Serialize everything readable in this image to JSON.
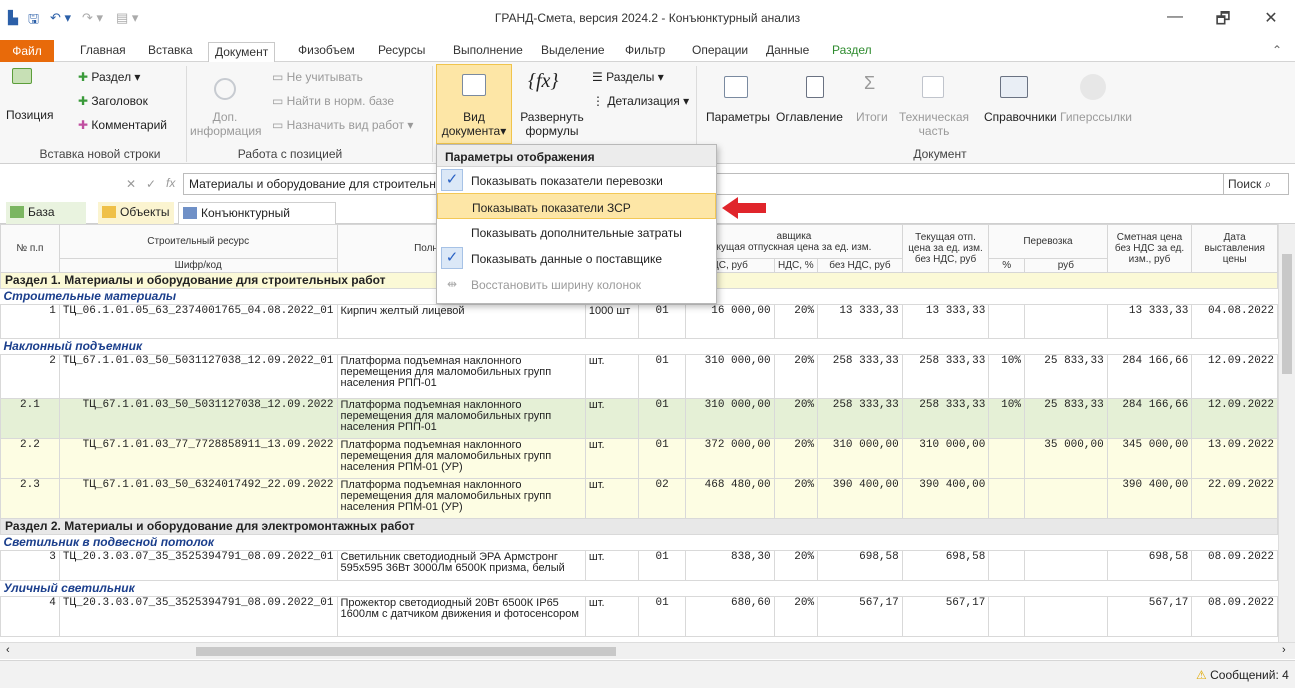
{
  "window": {
    "title": "ГРАНД-Смета, версия 2024.2 - Конъюнктурный анализ",
    "minimize": "—",
    "restore": "🗗",
    "close": "✕"
  },
  "tabs": {
    "file": "Файл",
    "items": [
      "Главная",
      "Вставка",
      "Документ",
      "Физобъем",
      "Ресурсы",
      "Выполнение",
      "Выделение",
      "Фильтр",
      "Операции",
      "Данные",
      "Раздел"
    ],
    "active": "Документ"
  },
  "ribbon": {
    "insert": {
      "position": "Позиция",
      "section": "Раздел",
      "heading": "Заголовок",
      "comment": "Комментарий",
      "group": "Вставка новой строки"
    },
    "work": {
      "info1": "Доп.",
      "info2": "информация",
      "ignore": "Не учитывать",
      "find": "Найти в норм. базе",
      "assign": "Назначить вид работ",
      "group": "Работа с позицией"
    },
    "view": {
      "label1": "Вид",
      "label2": "документа",
      "expand1": "Развернуть",
      "expand2": "формулы",
      "sections": "Разделы",
      "detail": "Детализация"
    },
    "doc": {
      "params": "Параметры",
      "toc": "Оглавление",
      "totals": "Итоги",
      "tech1": "Техническая",
      "tech2": "часть",
      "refs": "Справочники",
      "links": "Гиперссылки",
      "group": "Документ"
    }
  },
  "formula": {
    "value": "Материалы  и оборудование для строительных работ",
    "search": "Поиск"
  },
  "doctabs": {
    "base": "База",
    "objects": "Объекты",
    "market": "Конъюнктурный анализ",
    "close": "×"
  },
  "menu": {
    "header": "Параметры отображения",
    "items": [
      {
        "label": "Показывать показатели перевозки",
        "checked": true,
        "state": "normal"
      },
      {
        "label": "Показывать показатели ЗСР",
        "checked": false,
        "state": "highlight"
      },
      {
        "label": "Показывать дополнительные затраты",
        "checked": false,
        "state": "normal"
      },
      {
        "label": "Показывать данные о поставщике",
        "checked": true,
        "state": "normal"
      },
      {
        "label": "Восстановить ширину колонок",
        "checked": false,
        "state": "disabled"
      }
    ]
  },
  "grid": {
    "headers": {
      "num": "№ п.п",
      "resource": "Строительный ресурс",
      "code": "Шифр/код",
      "fullname": "Полное наименован",
      "supplier": "авщика",
      "supplier_sub": "кущая отпускная цена за ед. изм.",
      "nds_price": "ДС, руб",
      "nds": "НДС, %",
      "no_nds": "без НДС, руб",
      "cur_price": "Текущая отп. цена за ед. изм. без НДС, руб",
      "transport": "Перевозка",
      "tr_pct": "%",
      "tr_rub": "руб",
      "est_price": "Сметная цена без НДС за ед. изм., руб",
      "date": "Дата выставления цены"
    },
    "rows": [
      {
        "type": "section",
        "text": "Раздел 1. Материалы  и оборудование для строительных работ",
        "hl": true
      },
      {
        "type": "group",
        "text": "Строительные материалы"
      },
      {
        "type": "item",
        "n": "1",
        "code": "ТЦ_06.1.01.05_63_2374001765_04.08.2022_01",
        "name": "Кирпич желтый лицевой",
        "unit": "1000 шт",
        "k": "01",
        "price": "16 000,00",
        "nds": "20%",
        "nonds": "13 333,33",
        "cur": "13 333,33",
        "trp": "",
        "trr": "",
        "est": "13 333,33",
        "date": "04.08.2022",
        "cls": ""
      },
      {
        "type": "group",
        "text": "Наклонный подъемник"
      },
      {
        "type": "item",
        "n": "2",
        "code": "ТЦ_67.1.01.03_50_5031127038_12.09.2022_01",
        "name": "Платформа подъемная наклонного перемещения для маломобильных групп населения РПП-01",
        "unit": "шт.",
        "k": "01",
        "price": "310 000,00",
        "nds": "20%",
        "nonds": "258 333,33",
        "cur": "258 333,33",
        "trp": "10%",
        "trr": "25 833,33",
        "est": "284 166,66",
        "date": "12.09.2022",
        "cls": ""
      },
      {
        "type": "item",
        "n": "2.1",
        "code": "ТЦ_67.1.01.03_50_5031127038_12.09.2022",
        "name": "Платформа подъемная наклонного перемещения для маломобильных групп населения РПП-01",
        "unit": "шт.",
        "k": "01",
        "price": "310 000,00",
        "nds": "20%",
        "nonds": "258 333,33",
        "cur": "258 333,33",
        "trp": "10%",
        "trr": "25 833,33",
        "est": "284 166,66",
        "date": "12.09.2022",
        "cls": "green"
      },
      {
        "type": "item",
        "n": "2.2",
        "code": "ТЦ_67.1.01.03_77_7728858911_13.09.2022",
        "name": "Платформа подъемная наклонного перемещения для маломобильных групп населения РПМ-01 (УР)",
        "unit": "шт.",
        "k": "01",
        "price": "372 000,00",
        "nds": "20%",
        "nonds": "310 000,00",
        "cur": "310 000,00",
        "trp": "",
        "trr": "35 000,00",
        "est": "345 000,00",
        "date": "13.09.2022",
        "cls": "yel"
      },
      {
        "type": "item",
        "n": "2.3",
        "code": "ТЦ_67.1.01.03_50_6324017492_22.09.2022",
        "name": "Платформа подъемная наклонного перемещения для маломобильных групп населения РПМ-01 (УР)",
        "unit": "шт.",
        "k": "02",
        "price": "468 480,00",
        "nds": "20%",
        "nonds": "390 400,00",
        "cur": "390 400,00",
        "trp": "",
        "trr": "",
        "est": "390 400,00",
        "date": "22.09.2022",
        "cls": "yel"
      },
      {
        "type": "section",
        "text": "Раздел 2. Материалы и оборудование для электромонтажных работ",
        "hl": false
      },
      {
        "type": "group",
        "text": "Светильник в подвесной потолок"
      },
      {
        "type": "item",
        "n": "3",
        "code": "ТЦ_20.3.03.07_35_3525394791_08.09.2022_01",
        "name": "Светильник светодиодный ЭРА Армстронг 595х595 36Вт 3000Лм 6500К призма, белый",
        "unit": "шт.",
        "k": "01",
        "price": "838,30",
        "nds": "20%",
        "nonds": "698,58",
        "cur": "698,58",
        "trp": "",
        "trr": "",
        "est": "698,58",
        "date": "08.09.2022",
        "cls": ""
      },
      {
        "type": "group",
        "text": "Уличный светильник"
      },
      {
        "type": "item",
        "n": "4",
        "code": "ТЦ_20.3.03.07_35_3525394791_08.09.2022_01",
        "name": "Прожектор светодиодный 20Вт 6500К IP65 1600лм с датчиком движения и фотосенсором",
        "unit": "шт.",
        "k": "01",
        "price": "680,60",
        "nds": "20%",
        "nonds": "567,17",
        "cur": "567,17",
        "trp": "",
        "trr": "",
        "est": "567,17",
        "date": "08.09.2022",
        "cls": ""
      }
    ]
  },
  "status": {
    "messages": "Сообщений: 4"
  },
  "colors": {
    "file_tab": "#e86a0a",
    "menu_highlight": "#fde6a6",
    "arrow": "#e0252b",
    "group_text": "#1a3e8c"
  }
}
